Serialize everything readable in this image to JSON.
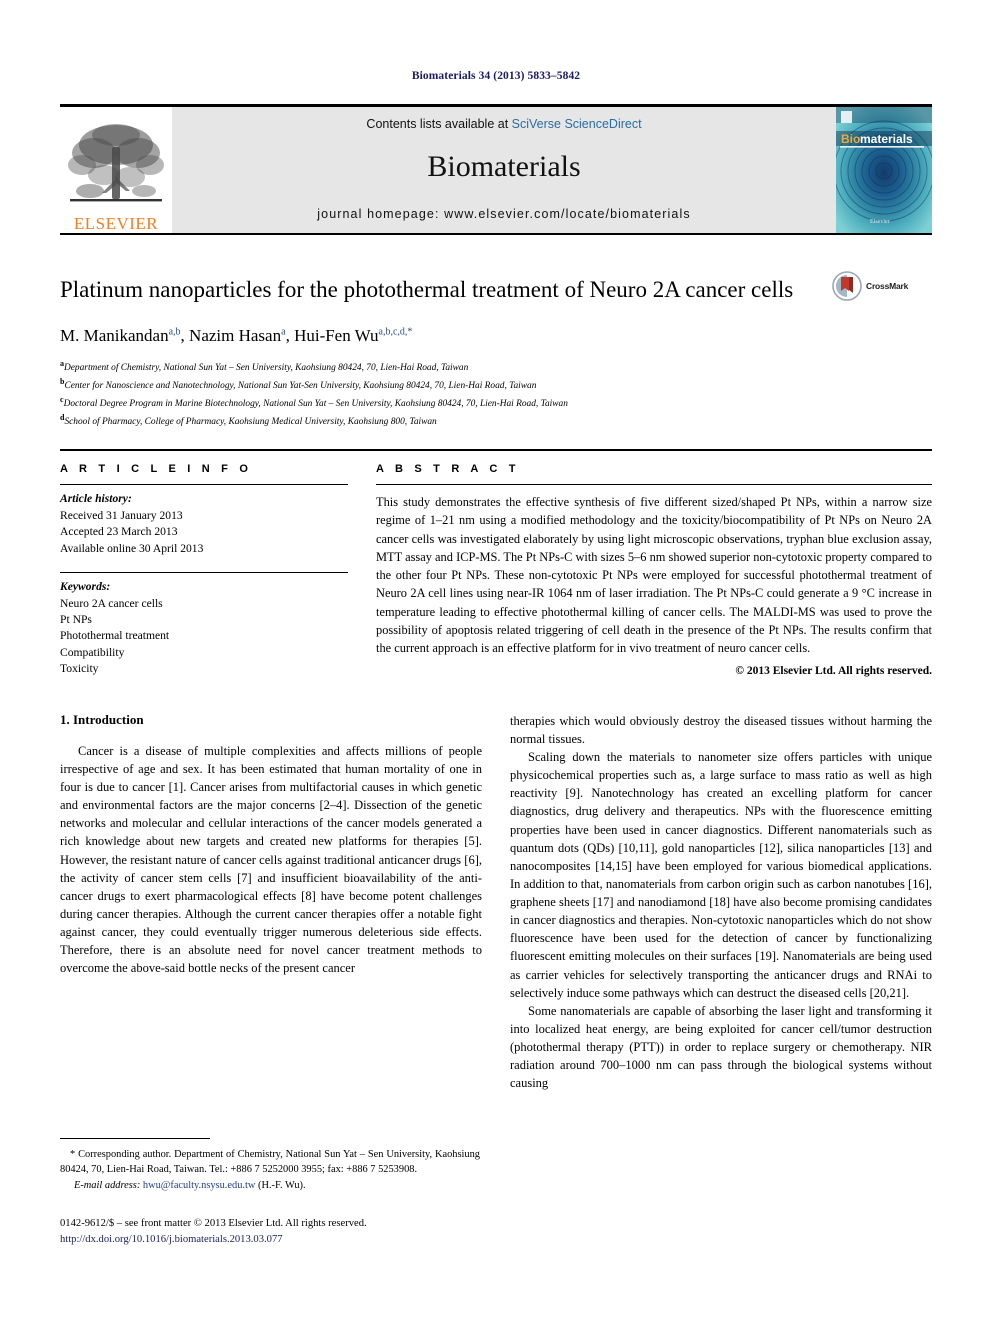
{
  "running_head": "Biomaterials 34 (2013) 5833–5842",
  "masthead": {
    "contents_prefix": "Contents lists available at ",
    "sciencedirect": "SciVerse ScienceDirect",
    "journal_name": "Biomaterials",
    "homepage": "journal homepage: www.elsevier.com/locate/biomaterials",
    "publisher_logo_text": "ELSEVIER",
    "cover_title_a": "Bio",
    "cover_title_b": "materials",
    "cover_footer": "Elsevier"
  },
  "title_block": {
    "title": "Platinum nanoparticles for the photothermal treatment of Neuro 2A cancer cells",
    "crossmark_label": "CrossMark",
    "authors": [
      {
        "name": "M. Manikandan",
        "marks": "a,b",
        "sep": ", "
      },
      {
        "name": "Nazim Hasan",
        "marks": "a",
        "sep": ", "
      },
      {
        "name": "Hui-Fen Wu",
        "marks": "a,b,c,d,*",
        "sep": ""
      }
    ],
    "affiliations": [
      {
        "mark": "a",
        "text": "Department of Chemistry, National Sun Yat – Sen University, Kaohsiung 80424, 70, Lien-Hai Road, Taiwan"
      },
      {
        "mark": "b",
        "text": "Center for Nanoscience and Nanotechnology, National Sun Yat-Sen University, Kaohsiung 80424, 70, Lien-Hai Road, Taiwan"
      },
      {
        "mark": "c",
        "text": "Doctoral Degree Program in Marine Biotechnology, National Sun Yat – Sen University, Kaohsiung 80424, 70, Lien-Hai Road, Taiwan"
      },
      {
        "mark": "d",
        "text": "School of Pharmacy, College of Pharmacy, Kaohsiung Medical University, Kaohsiung 800, Taiwan"
      }
    ]
  },
  "article_info": {
    "heading": "A R T I C L E  I N F O",
    "history_title": "Article history:",
    "history": [
      "Received 31 January 2013",
      "Accepted 23 March 2013",
      "Available online 30 April 2013"
    ],
    "keywords_title": "Keywords:",
    "keywords": [
      "Neuro 2A cancer cells",
      "Pt NPs",
      "Photothermal treatment",
      "Compatibility",
      "Toxicity"
    ]
  },
  "abstract": {
    "heading": "A B S T R A C T",
    "text": "This study demonstrates the effective synthesis of five different sized/shaped Pt NPs, within a narrow size regime of 1–21 nm using a modified methodology and the toxicity/biocompatibility of Pt NPs on Neuro 2A cancer cells was investigated elaborately by using light microscopic observations, tryphan blue exclusion assay, MTT assay and ICP-MS. The Pt NPs-C with sizes 5–6 nm showed superior non-cytotoxic property compared to the other four Pt NPs. These non-cytotoxic Pt NPs were employed for successful photothermal treatment of Neuro 2A cell lines using near-IR 1064 nm of laser irradiation. The Pt NPs-C could generate a 9 °C increase in temperature leading to effective photothermal killing of cancer cells. The MALDI-MS was used to prove the possibility of apoptosis related triggering of cell death in the presence of the Pt NPs. The results confirm that the current approach is an effective platform for in vivo treatment of neuro cancer cells.",
    "copyright": "© 2013 Elsevier Ltd. All rights reserved."
  },
  "body": {
    "section_number_title": "1.  Introduction",
    "left_paragraph": "Cancer is a disease of multiple complexities and affects millions of people irrespective of age and sex. It has been estimated that human mortality of one in four is due to cancer [1]. Cancer arises from multifactorial causes in which genetic and environmental factors are the major concerns [2–4]. Dissection of the genetic networks and molecular and cellular interactions of the cancer models generated a rich knowledge about new targets and created new platforms for therapies [5]. However, the resistant nature of cancer cells against traditional anticancer drugs [6], the activity of cancer stem cells [7] and insufficient bioavailability of the anti-cancer drugs to exert pharmacological effects [8] have become potent challenges during cancer therapies. Although the current cancer therapies offer a notable fight against cancer, they could eventually trigger numerous deleterious side effects. Therefore, there is an absolute need for novel cancer treatment methods to overcome the above-said bottle necks of the present cancer",
    "right_paragraph_1": "therapies which would obviously destroy the diseased tissues without harming the normal tissues.",
    "right_paragraph_2": "Scaling down the materials to nanometer size offers particles with unique physicochemical properties such as, a large surface to mass ratio as well as high reactivity [9]. Nanotechnology has created an excelling platform for cancer diagnostics, drug delivery and therapeutics. NPs with the fluorescence emitting properties have been used in cancer diagnostics. Different nanomaterials such as quantum dots (QDs) [10,11], gold nanoparticles [12], silica nanoparticles [13] and nanocomposites [14,15] have been employed for various biomedical applications. In addition to that, nanomaterials from carbon origin such as carbon nanotubes [16], graphene sheets [17] and nanodiamond [18] have also become promising candidates in cancer diagnostics and therapies. Non-cytotoxic nanoparticles which do not show fluorescence have been used for the detection of cancer by functionalizing fluorescent emitting molecules on their surfaces [19]. Nanomaterials are being used as carrier vehicles for selectively transporting the anticancer drugs and RNAi to selectively induce some pathways which can destruct the diseased cells [20,21].",
    "right_paragraph_3": "Some nanomaterials are capable of absorbing the laser light and transforming it into localized heat energy, are being exploited for cancer cell/tumor destruction (photothermal therapy (PTT)) in order to replace surgery or chemotherapy. NIR radiation around 700–1000 nm can pass through the biological systems without causing"
  },
  "footnote": {
    "corresponding": "* Corresponding author. Department of Chemistry, National Sun Yat – Sen University, Kaohsiung 80424, 70, Lien-Hai Road, Taiwan. Tel.: +886 7 5252000 3955; fax: +886 7 5253908.",
    "email_label": "E-mail address:",
    "email": "hwu@faculty.nsysu.edu.tw",
    "email_suffix": "(H.-F. Wu)."
  },
  "footer": {
    "issn_line": "0142-9612/$ – see front matter © 2013 Elsevier Ltd. All rights reserved.",
    "doi": "http://dx.doi.org/10.1016/j.biomaterials.2013.03.077"
  },
  "colors": {
    "running_head": "#1a1a66",
    "reference_link": "#1f3f8f",
    "sciencedirect_link": "#2b6ca3",
    "elsevier_orange": "#F57C20",
    "band_gray": "#e6e6e6"
  }
}
